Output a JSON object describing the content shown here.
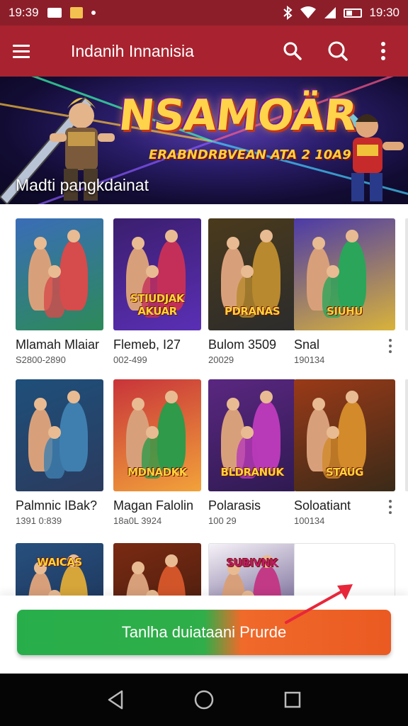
{
  "status_bar": {
    "time_left": "19:39",
    "time_right": "19:30"
  },
  "app_bar": {
    "title": "Indanih Innanisia"
  },
  "banner": {
    "title": "NSAMOÄR",
    "subtitle": "ERABNDRBVEAN ATA 2 10A9",
    "caption": "Madti pangkdainat"
  },
  "games": [
    {
      "name": "Mlamah Mlaiar",
      "meta": "S2800-2890",
      "thumb_label": "",
      "colors": [
        "#3a6db8",
        "#d64b4b",
        "#2c8a58"
      ]
    },
    {
      "name": "Flemeb, I27",
      "meta": "002-499",
      "thumb_label": "STIUDJAK AKUAR",
      "colors": [
        "#3b1e6e",
        "#c42f5a",
        "#5a2fb5"
      ]
    },
    {
      "name": "Bulom 3509",
      "meta": "20029",
      "thumb_label": "PDRANAS",
      "colors": [
        "#4a3a1c",
        "#b8892e",
        "#2c2c2c"
      ]
    },
    {
      "name": "Snal",
      "meta": "190134",
      "thumb_label": "SIUHU",
      "colors": [
        "#4b3aa8",
        "#2aa55a",
        "#d9b33a"
      ]
    },
    {
      "name": "Palmnic IBak?",
      "meta": "1391 0:839",
      "thumb_label": "",
      "colors": [
        "#1e4f7a",
        "#3f7fb0",
        "#2b3b5e"
      ]
    },
    {
      "name": "Magan Falolin",
      "meta": "18a0L 3924",
      "thumb_label": "MDNADKK",
      "colors": [
        "#c8343a",
        "#2e9a4a",
        "#f2a23a"
      ]
    },
    {
      "name": "Polarasis",
      "meta": "100 29",
      "thumb_label": "BLDRANUK",
      "colors": [
        "#5a2780",
        "#b83ab8",
        "#2f1a52"
      ]
    },
    {
      "name": "Soloatiant",
      "meta": "100134",
      "thumb_label": "STAUG",
      "colors": [
        "#9a3a18",
        "#d28a2a",
        "#3a2a18"
      ]
    },
    {
      "name": "",
      "meta": "",
      "thumb_label": "WAICAS",
      "colors": [
        "#27507e",
        "#d6a63a",
        "#1a2c4e"
      ]
    },
    {
      "name": "",
      "meta": "",
      "thumb_label": "",
      "colors": [
        "#7a2a12",
        "#d2552a",
        "#3a1a0e"
      ]
    },
    {
      "name": "",
      "meta": "",
      "thumb_label": "SUBIVNK",
      "colors": [
        "#f6f2f8",
        "#c23a86",
        "#3a2a6a"
      ]
    },
    {
      "name": "",
      "meta": "",
      "thumb_label": "",
      "colors": [
        "#ffffff",
        "#ffffff",
        "#ffffff"
      ]
    }
  ],
  "cta": {
    "label": "Tanlha duiataani Prurde"
  },
  "icons": {
    "menu": "hamburger-icon",
    "search": "search-icon",
    "search2": "search-icon",
    "more": "more-vert-icon",
    "back": "back-triangle-icon",
    "home": "home-circle-icon",
    "recents": "recents-square-icon"
  }
}
